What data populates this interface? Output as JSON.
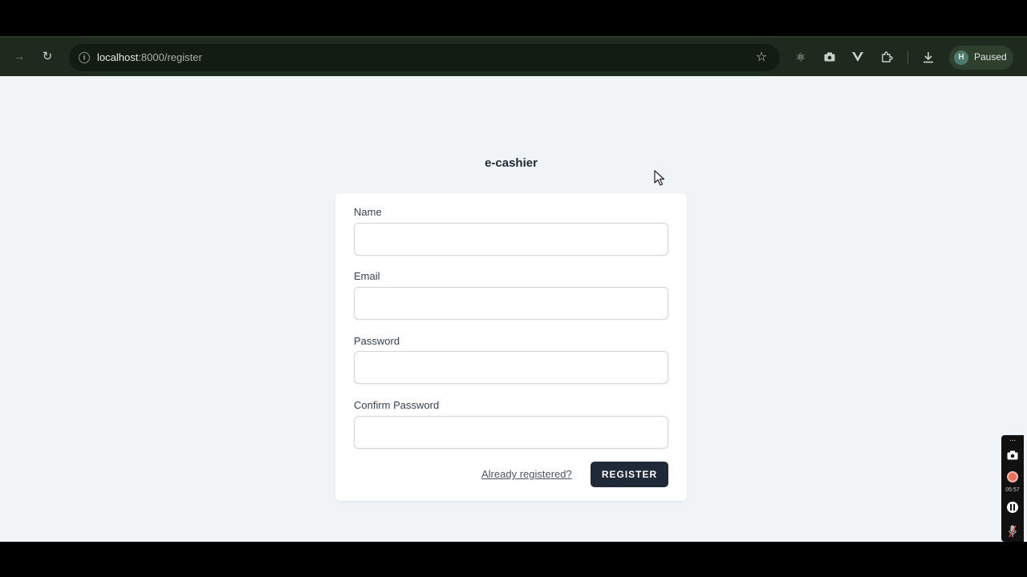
{
  "browser": {
    "url_host": "localhost",
    "url_rest": ":8000/register",
    "profile_initial": "H",
    "profile_status": "Paused"
  },
  "page": {
    "brand": "e-cashier",
    "fields": [
      {
        "label": "Name",
        "value": ""
      },
      {
        "label": "Email",
        "value": ""
      },
      {
        "label": "Password",
        "value": ""
      },
      {
        "label": "Confirm Password",
        "value": ""
      }
    ],
    "login_link": "Already registered?",
    "submit_label": "REGISTER"
  },
  "recorder": {
    "time": "05:57"
  },
  "colors": {
    "toolbar_bg": "#1e2a1e",
    "page_bg": "#f1f4f6",
    "button_bg": "#1f2937"
  }
}
